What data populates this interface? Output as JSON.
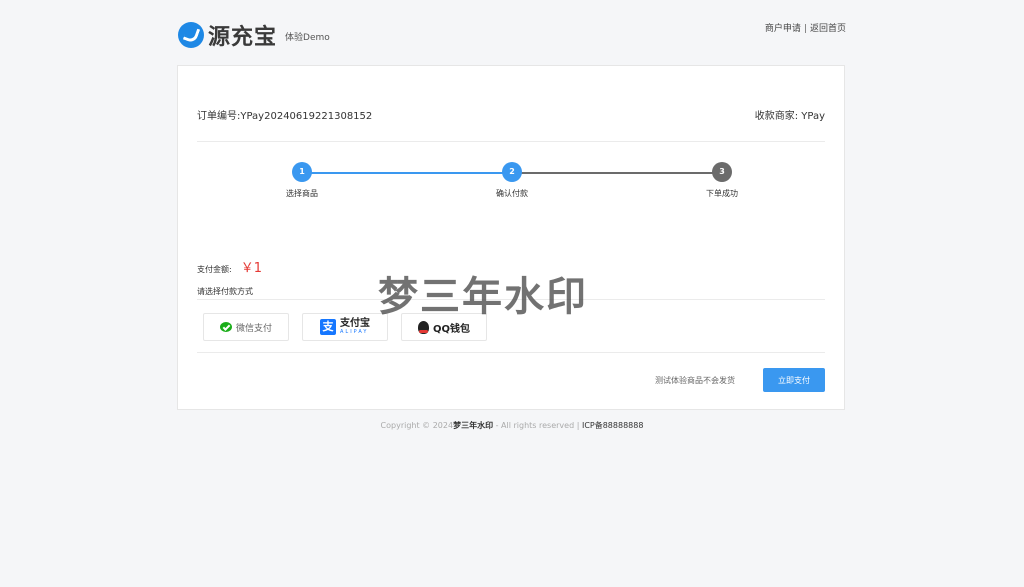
{
  "header": {
    "logo_text": "源充宝",
    "logo_sub": "体验Demo",
    "links": [
      "商户申请",
      "返回首页"
    ],
    "link_separator": "|"
  },
  "order": {
    "order_no": "订单编号:YPay20240619221308152",
    "merchant": "收款商家: YPay"
  },
  "steps": [
    {
      "num": "1",
      "label": "选择商品",
      "color": "#3a98f0"
    },
    {
      "num": "2",
      "label": "确认付款",
      "color": "#3a98f0"
    },
    {
      "num": "3",
      "label": "下单成功",
      "color": "#6b6b6b"
    }
  ],
  "colors": {
    "accent": "#3a98f0",
    "inactive": "#6b6b6b",
    "amount": "#e53935"
  },
  "payment": {
    "amount_label": "支付金额:",
    "amount_value": "￥1",
    "method_label": "请选择付款方式",
    "methods": {
      "wechat": "微信支付",
      "alipay_cn": "支付宝",
      "alipay_en": "ALIPAY",
      "qq": "QQ钱包"
    }
  },
  "actions": {
    "notice": "测试体验商品不会发货",
    "pay_now": "立即支付"
  },
  "footer": {
    "copyright_prefix": "Copyright © 2024",
    "brand": "梦三年水印",
    "rights": " - All rights reserved | ",
    "icp": "ICP备88888888"
  },
  "watermark": "梦三年水印"
}
